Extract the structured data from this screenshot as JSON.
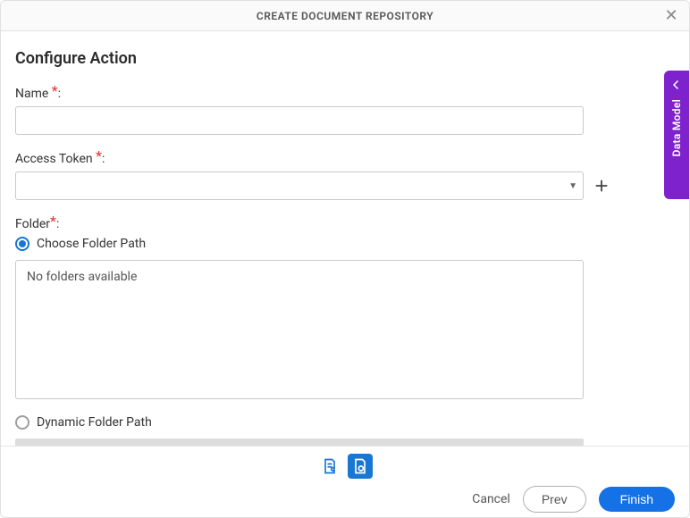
{
  "modal": {
    "title": "CREATE DOCUMENT REPOSITORY",
    "heading": "Configure Action"
  },
  "fields": {
    "name": {
      "label": "Name",
      "colon": ":",
      "value": ""
    },
    "access_token": {
      "label": "Access Token",
      "colon": ":",
      "value": ""
    },
    "folder": {
      "label": "Folder",
      "colon": ":"
    }
  },
  "folder_radios": {
    "choose": "Choose Folder Path",
    "dynamic": "Dynamic Folder Path"
  },
  "folder_box": {
    "empty_text": "No folders available"
  },
  "footer": {
    "cancel": "Cancel",
    "prev": "Prev",
    "finish": "Finish"
  },
  "side_tab": {
    "label": "Data Model"
  }
}
